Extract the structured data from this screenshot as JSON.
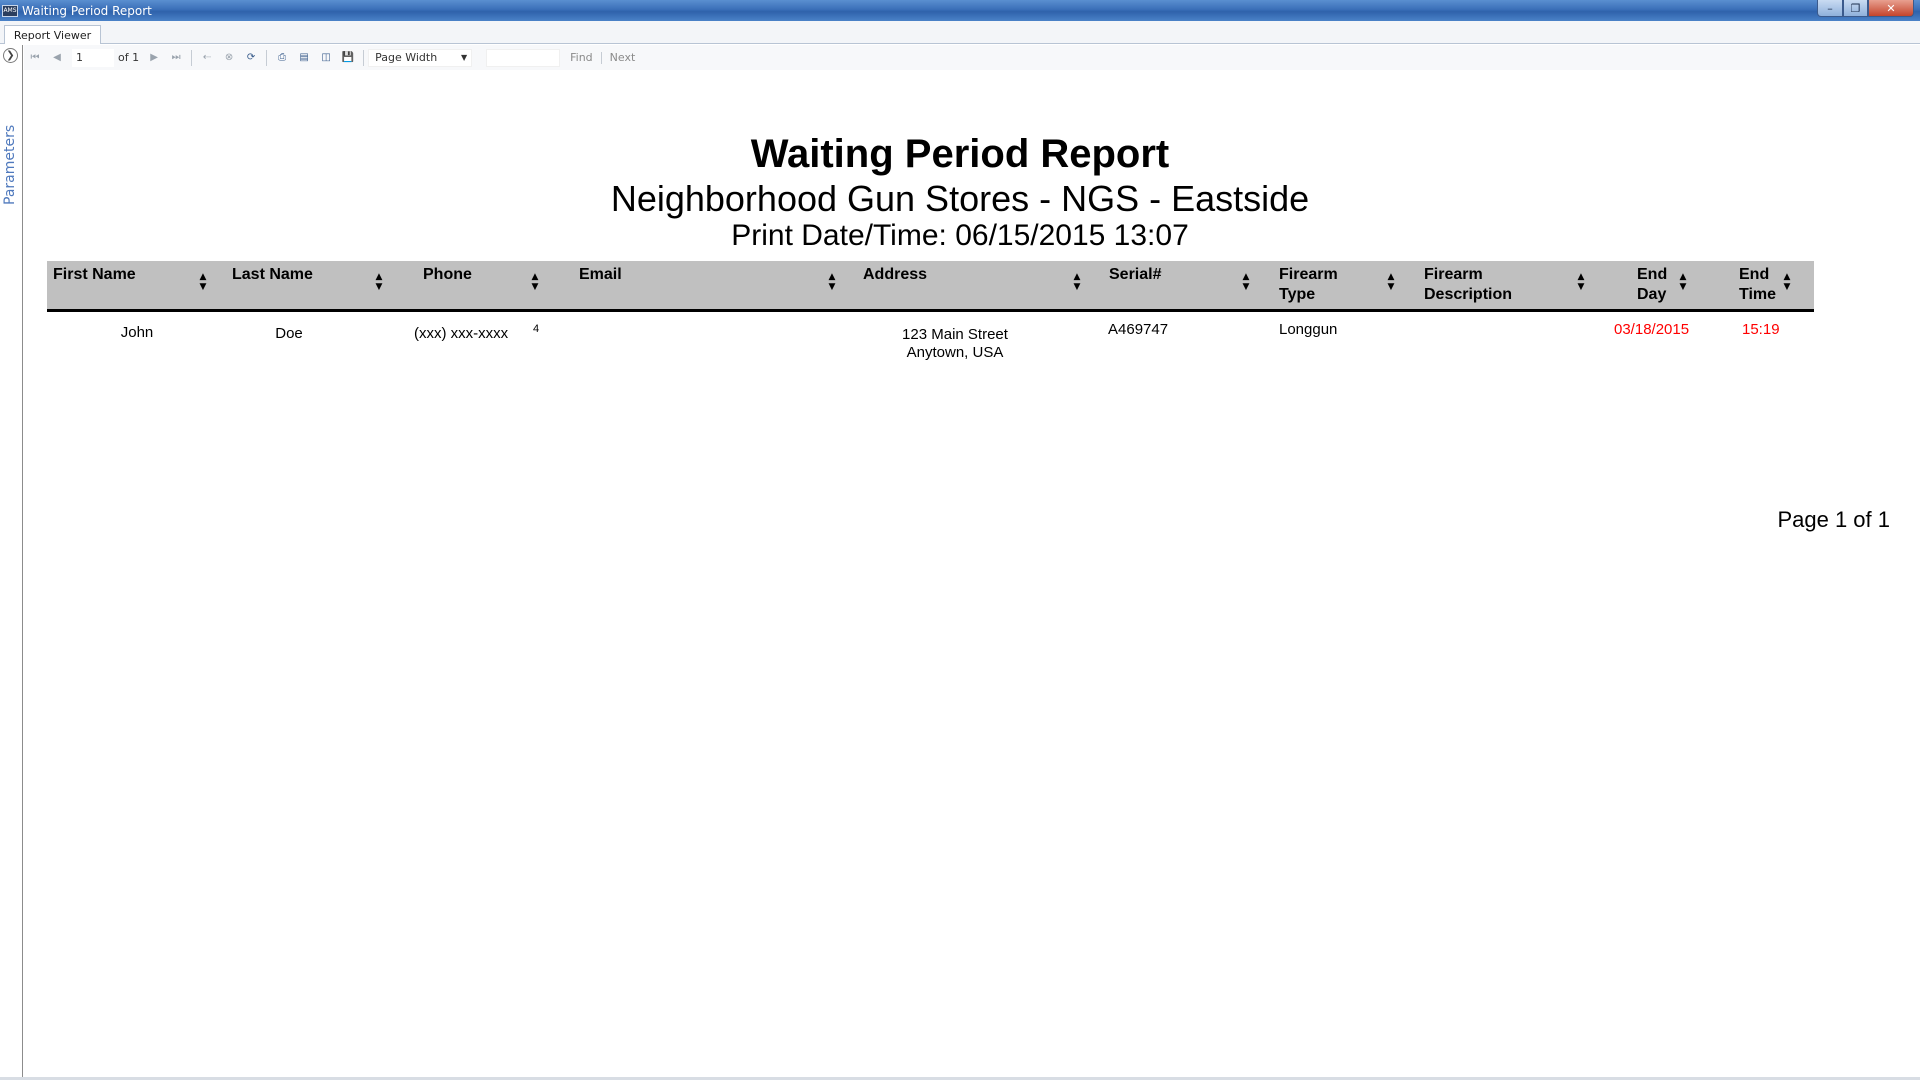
{
  "window": {
    "title": "Waiting Period Report",
    "icon_text": "AMS",
    "controls": [
      "minimize",
      "maximize",
      "close"
    ]
  },
  "tabs": [
    {
      "label": "Report Viewer",
      "active": true
    }
  ],
  "parameters_panel": {
    "label": "Parameters"
  },
  "toolbar": {
    "current_page": "1",
    "page_count_text": "of 1",
    "zoom": "Page Width",
    "find_label": "Find",
    "next_label": "Next"
  },
  "report": {
    "title": "Waiting Period Report",
    "store": "Neighborhood Gun Stores - NGS - Eastside",
    "print_datetime": "Print Date/Time: 06/15/2015 13:07",
    "columns": [
      {
        "line1": "First Name",
        "line2": ""
      },
      {
        "line1": "Last Name",
        "line2": ""
      },
      {
        "line1": "Phone",
        "line2": ""
      },
      {
        "line1": "Email",
        "line2": ""
      },
      {
        "line1": "Address",
        "line2": ""
      },
      {
        "line1": "Serial#",
        "line2": ""
      },
      {
        "line1": "Firearm",
        "line2": "Type"
      },
      {
        "line1": "Firearm",
        "line2": "Description"
      },
      {
        "line1": "End",
        "line2": "Day"
      },
      {
        "line1": "End",
        "line2": "Time"
      }
    ],
    "rows": [
      {
        "first_name": "John",
        "last_name": "Doe",
        "phone": "(xxx) xxx-xxxx",
        "phone_ext": "4",
        "email": "",
        "address_line1": "123 Main Street",
        "address_line2": "Anytown, USA",
        "serial": "A469747",
        "firearm_type": "Longgun",
        "firearm_description": "",
        "end_day": "03/18/2015",
        "end_time": "15:19"
      }
    ],
    "page_footer": "Page 1 of 1",
    "highlight_color": "#ff0000"
  }
}
